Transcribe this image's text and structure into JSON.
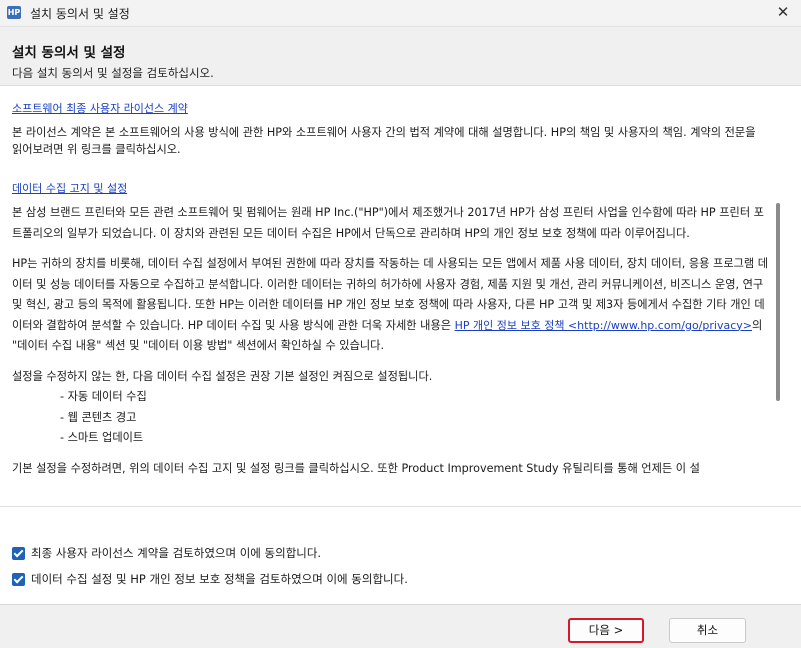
{
  "window": {
    "title": "설치 동의서 및 설정",
    "app_icon_text": "HP",
    "close_glyph": "✕"
  },
  "header": {
    "title": "설치 동의서 및 설정",
    "subtitle": "다음 설치 동의서 및 설정을 검토하십시오."
  },
  "eula": {
    "link": "소프트웨어 최종 사용자 라이선스 계약",
    "description": "본 라이선스 계약은 본 소프트웨어의 사용 방식에 관한 HP와 소프트웨어 사용자 간의 법적 계약에 대해 설명합니다. HP의 책임 및 사용자의 책임. 계약의 전문을 읽어보려면 위 링크를 클릭하십시오."
  },
  "data_collection": {
    "link": "데이터 수집 고지 및 설정",
    "para1": "본 삼성 브랜드 프린터와 모든 관련 소프트웨어 및 펌웨어는 원래 HP Inc.(\"HP\")에서 제조했거나 2017년 HP가 삼성 프린터 사업을 인수함에 따라 HP 프린터 포트폴리오의 일부가 되었습니다.  이 장치와 관련된 모든 데이터 수집은 HP에서 단독으로 관리하며 HP의 개인 정보 보호 정책에 따라 이루어집니다.",
    "para2_before": "HP는 귀하의 장치를 비롯해, 데이터 수집 설정에서 부여된 권한에 따라 장치를 작동하는 데 사용되는 모든 앱에서 제품 사용 데이터, 장치 데이터, 응용 프로그램 데이터 및 성능 데이터를 자동으로 수집하고 분석합니다. 이러한 데이터는 귀하의 허가하에 사용자 경험, 제품 지원 및 개선, 관리 커뮤니케이션, 비즈니스 운영, 연구 및 혁신, 광고 등의 목적에 활용됩니다. 또한 HP는 이러한 데이터를 HP 개인 정보 보호 정책에 따라 사용자, 다른 HP 고객 및 제3자 등에게서 수집한 기타 개인 데이터와 결합하여 분석할 수 있습니다. HP 데이터 수집 및 사용 방식에 관한 더욱 자세한 내용은 ",
    "privacy_link": "HP 개인 정보 보호 정책 <http://www.hp.com/go/privacy>",
    "para2_after": "의 \"데이터 수집 내용\" 섹션 및 \"데이터 이용 방법\" 섹션에서 확인하실 수 있습니다.",
    "para3": "설정을 수정하지 않는 한, 다음 데이터 수집 설정은 권장 기본 설정인 켜짐으로 설정됩니다.",
    "settings": [
      "- 자동 데이터 수집",
      "- 웹 콘텐츠 경고",
      "- 스마트 업데이트"
    ],
    "para4_partial": "기본 설정을 수정하려면, 위의 데이터 수집 고지 및 설정 링크를 클릭하십시오. 또한 Product Improvement Study 유틸리티를 통해 언제든 이 설"
  },
  "checkboxes": [
    {
      "label": "최종 사용자 라이선스 계약을 검토하였으며 이에 동의합니다.",
      "checked": true
    },
    {
      "label": "데이터 수집 설정 및 HP 개인 정보 보호 정책을 검토하였으며 이에 동의합니다.",
      "checked": true
    }
  ],
  "footer": {
    "next_label": "다음 >",
    "cancel_label": "취소"
  },
  "colors": {
    "link": "#1a3fc4",
    "checkbox": "#1f63b8",
    "highlight_border": "#d6182b"
  }
}
